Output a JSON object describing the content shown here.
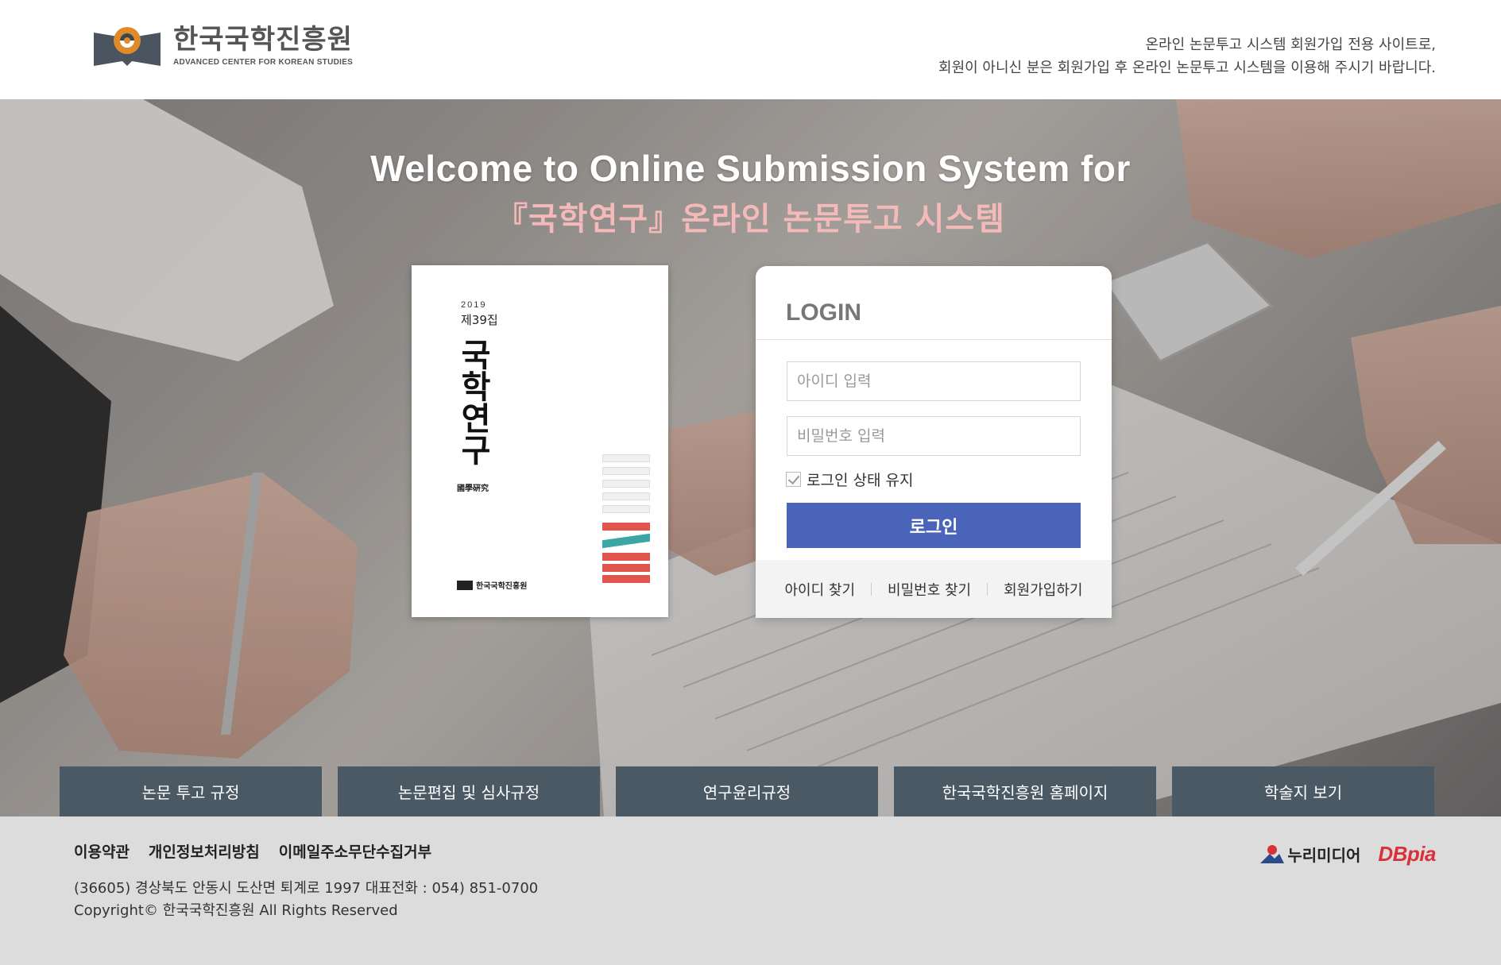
{
  "header": {
    "logo_ko": "한국국학진흥원",
    "logo_en": "ADVANCED CENTER FOR KOREAN STUDIES",
    "notice_line1": "온라인 논문투고 시스템 회원가입 전용 사이트로,",
    "notice_line2": "회원이 아니신 분은 회원가입 후 온라인 논문투고 시스템을 이용해 주시기 바랍니다."
  },
  "hero": {
    "title_en": "Welcome to Online Submission System for",
    "title_ko": "『국학연구』온라인 논문투고 시스템"
  },
  "cover": {
    "year": "2019",
    "volume": "제39집",
    "title_chars": [
      "국",
      "학",
      "연",
      "구"
    ],
    "hanja": "國學硏究",
    "publisher": "한국국학진흥원"
  },
  "login": {
    "title": "LOGIN",
    "id_placeholder": "아이디 입력",
    "pw_placeholder": "비밀번호 입력",
    "keep_label": "로그인 상태 유지",
    "keep_checked": true,
    "button": "로그인",
    "find_id": "아이디 찾기",
    "find_pw": "비밀번호 찾기",
    "signup": "회원가입하기"
  },
  "nav": [
    {
      "label": "논문 투고 규정"
    },
    {
      "label": "논문편집 및 심사규정"
    },
    {
      "label": "연구윤리규정"
    },
    {
      "label": "한국국학진흥원 홈페이지"
    },
    {
      "label": "학술지 보기"
    }
  ],
  "footer": {
    "links": [
      "이용약관",
      "개인정보처리방침",
      "이메일주소무단수집거부"
    ],
    "address": "(36605) 경상북도 안동시 도산면 퇴계로 1997 대표전화 : 054) 851-0700",
    "copyright": "Copyright© 한국국학진흥원 All Rights Reserved",
    "partner1": "누리미디어",
    "partner2": "DBpia"
  },
  "colors": {
    "accent": "#4964b8",
    "nav_bg": "#4b5965",
    "title_pink": "#f4b9b9",
    "dbpia_red": "#d8313a",
    "logo_orange": "#e08a2a"
  }
}
